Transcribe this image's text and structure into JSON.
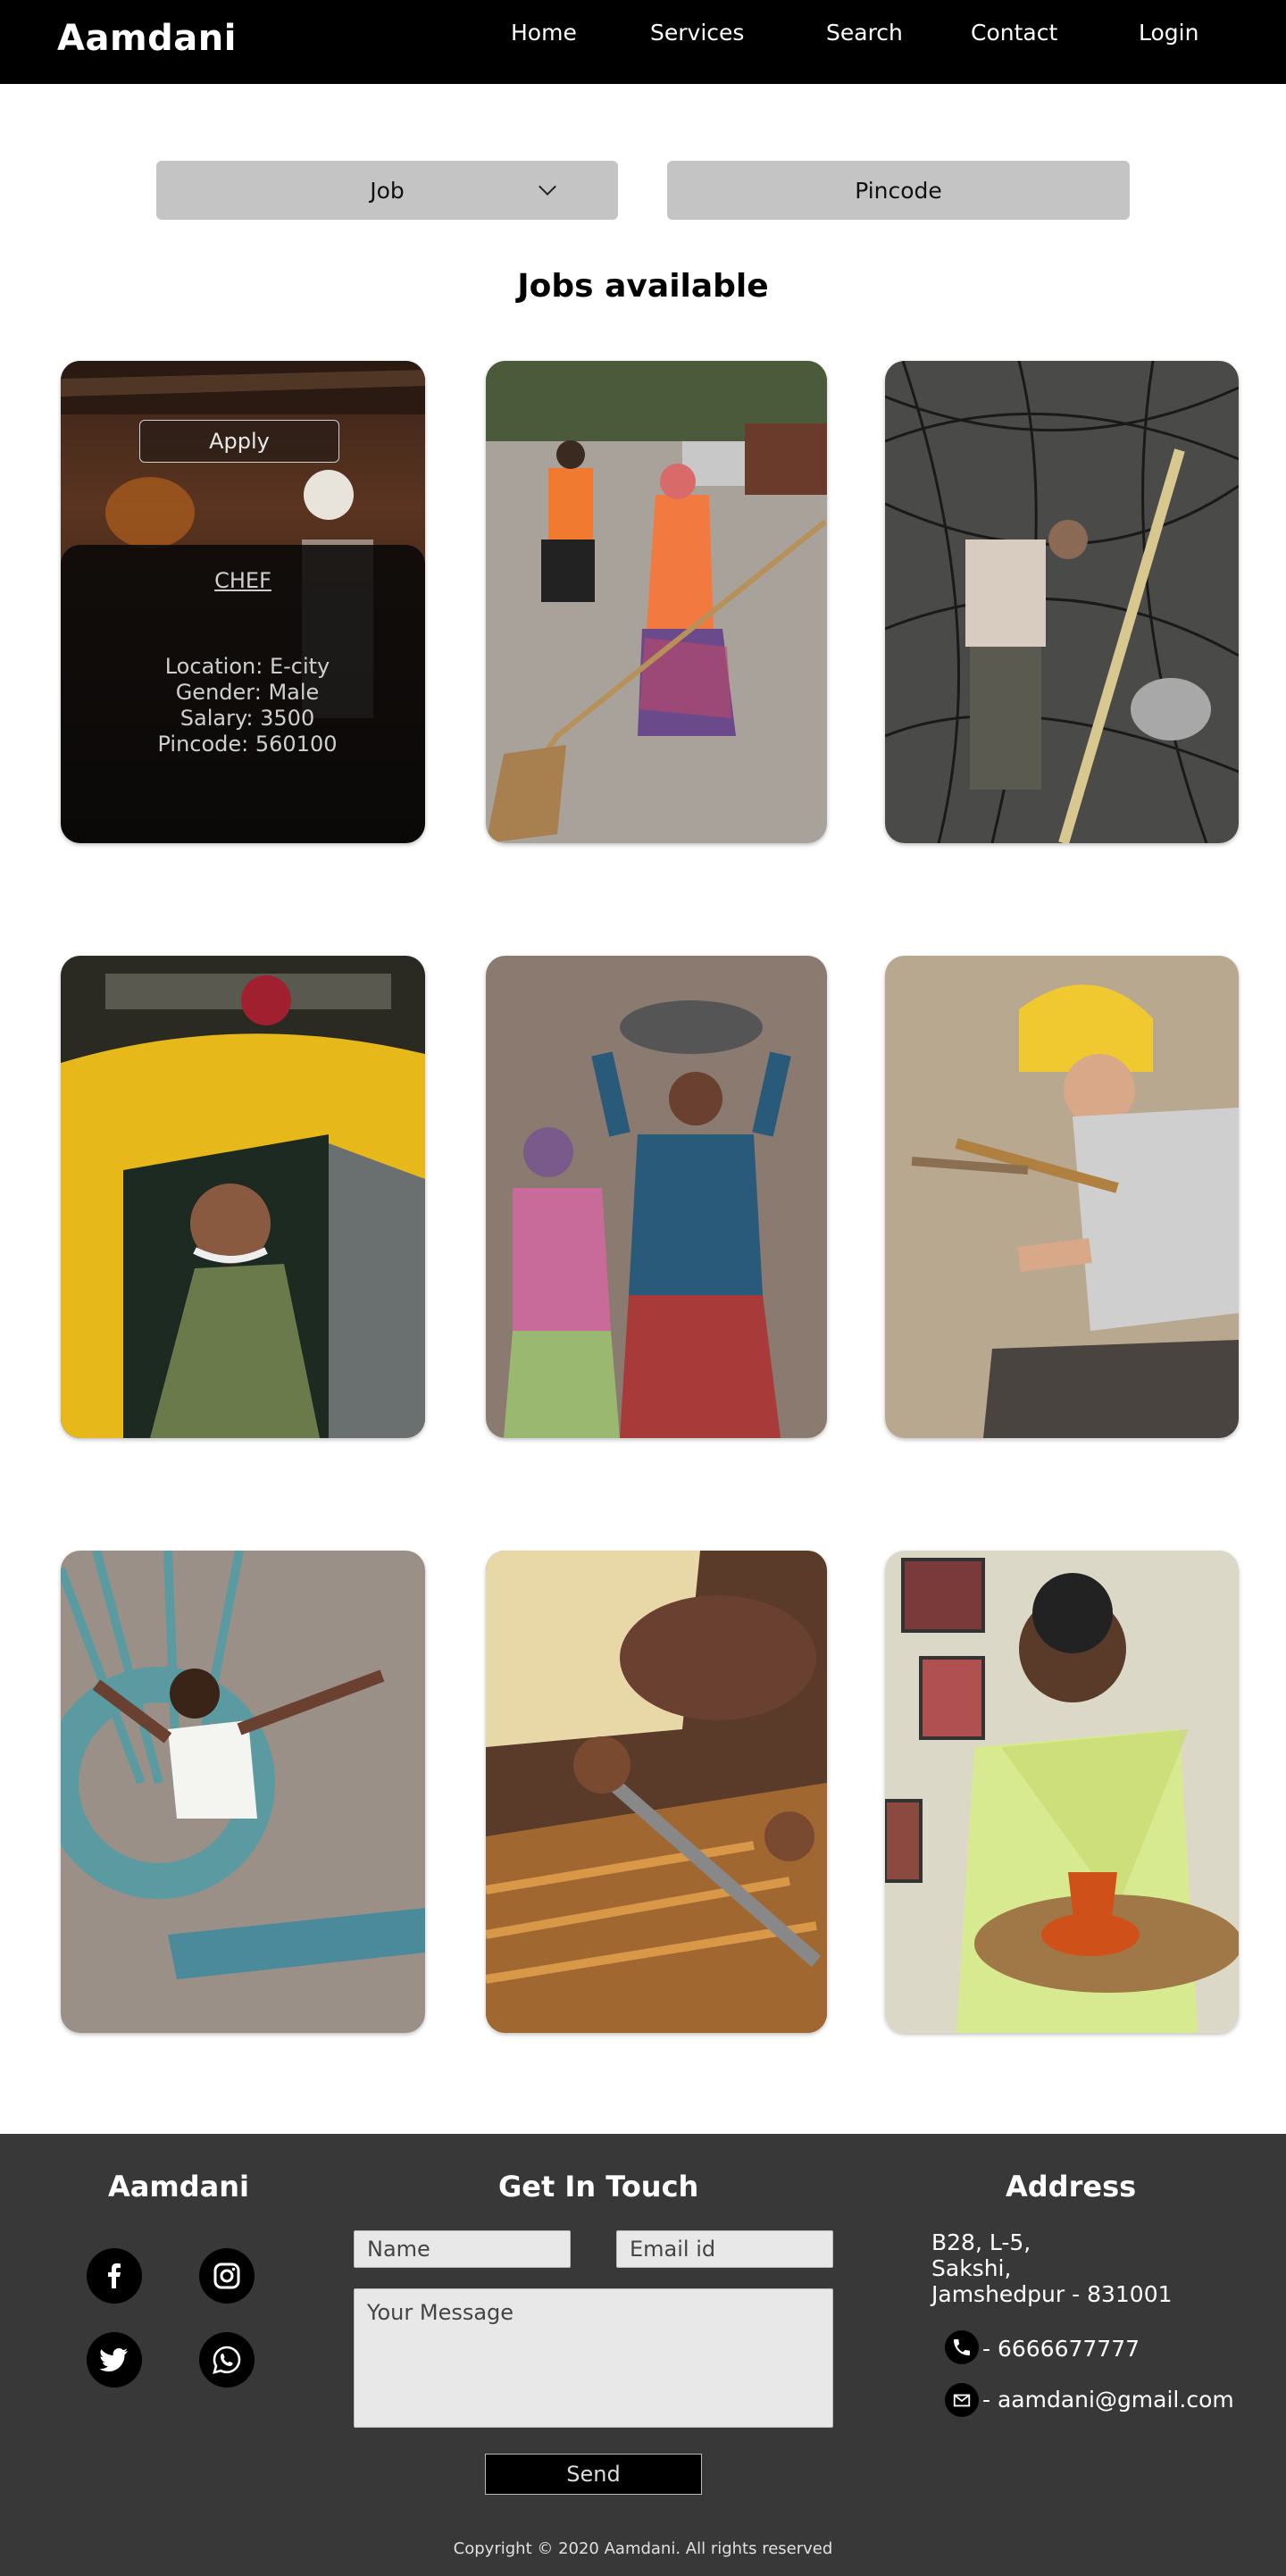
{
  "nav": {
    "brand": "Aamdani",
    "items": [
      "Home",
      "Services",
      "Search",
      "Contact",
      "Login"
    ]
  },
  "filters": {
    "job_label": "Job",
    "pincode_label": "Pincode"
  },
  "section_title": "Jobs available",
  "featured_job": {
    "apply_label": "Apply",
    "title": "CHEF",
    "location": "Location: E-city",
    "gender": "Gender: Male",
    "salary": "Salary: 3500",
    "pincode": "Pincode: 560100"
  },
  "footer": {
    "brand": "Aamdani",
    "get_in_touch": "Get In Touch",
    "name_placeholder": "Name",
    "email_placeholder": "Email id",
    "message_placeholder": "Your Message",
    "send_label": "Send",
    "address_heading": "Address",
    "address_lines": [
      "B28, L-5,",
      "Sakshi,",
      "Jamshedpur - 831001"
    ],
    "phone": "- 6666677777",
    "email": "- aamdani@gmail.com",
    "copyright": "Copyright © 2020 Aamdani. All rights reserved"
  },
  "colors": {
    "nav_bg": "#000000",
    "filter_bg": "#c4c4c4",
    "footer_bg": "#383838"
  },
  "icons": [
    "chevron-down-icon",
    "facebook-icon",
    "instagram-icon",
    "twitter-icon",
    "whatsapp-icon",
    "phone-icon",
    "mail-icon"
  ]
}
